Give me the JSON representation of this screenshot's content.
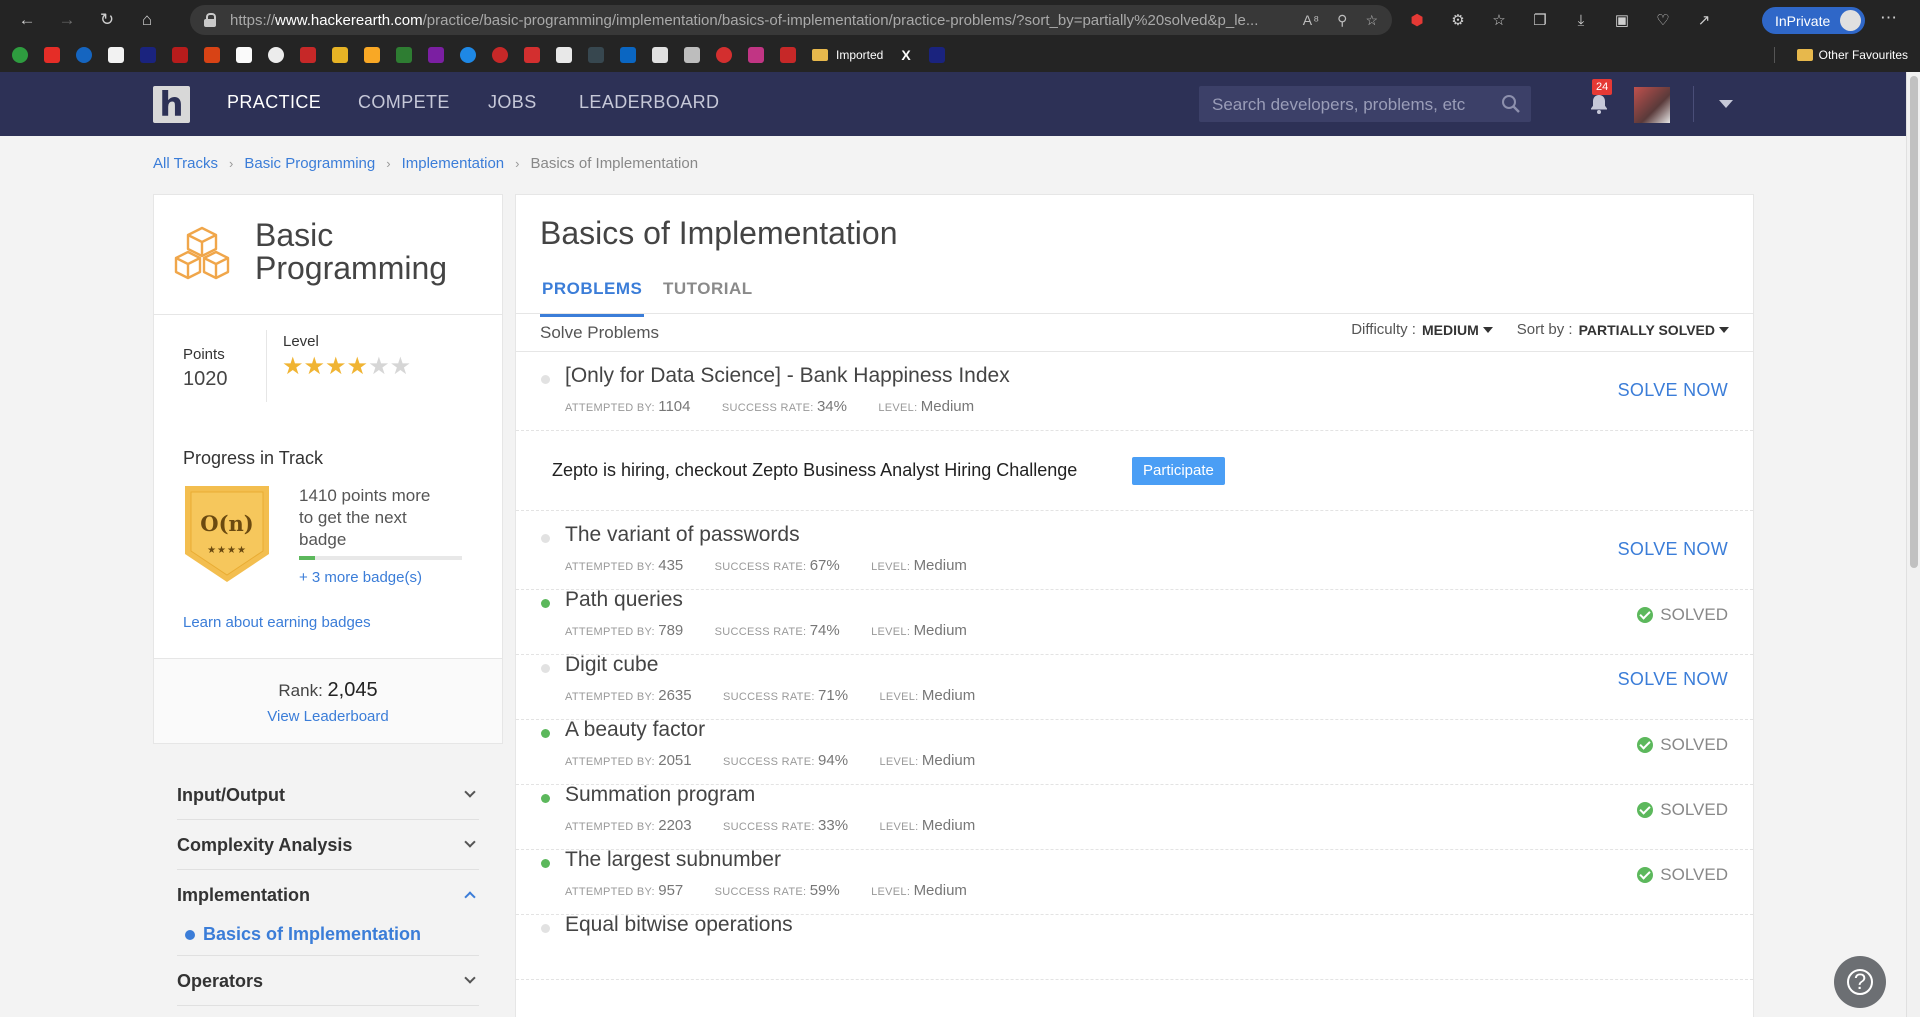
{
  "browser": {
    "url_proto": "https://",
    "url_host": "www.hackerearth.com",
    "url_path": "/practice/basic-programming/implementation/basics-of-implementation/practice-problems/?sort_by=partially%20solved&p_le...",
    "inprivate_label": "InPrivate",
    "bookmark_imported": "Imported",
    "bookmark_x": "X",
    "other_favourites": "Other Favourites"
  },
  "header": {
    "logo": "h",
    "nav": [
      "PRACTICE",
      "COMPETE",
      "JOBS",
      "LEADERBOARD"
    ],
    "search_placeholder": "Search developers, problems, etc",
    "notification_count": "24"
  },
  "breadcrumb": [
    "All Tracks",
    "Basic Programming",
    "Implementation",
    "Basics of Implementation"
  ],
  "track": {
    "title": "Basic Programming",
    "points_label": "Points",
    "points": "1020",
    "level_label": "Level",
    "level_stars": 4,
    "level_max": 6,
    "progress_title": "Progress in Track",
    "badge_text": "O(n)",
    "badge_stars": "★★★★",
    "progress_text": "1410 points more to get the next badge",
    "progress_fraction": 0.1,
    "more_badges": "+ 3 more badge(s)",
    "learn_link": "Learn about earning badges",
    "rank_label": "Rank:",
    "rank": "2,045",
    "view_leaderboard": "View Leaderboard"
  },
  "topics": {
    "items": [
      "Input/Output",
      "Complexity Analysis",
      "Implementation",
      "Operators"
    ],
    "sub_active": "Basics of Implementation"
  },
  "main": {
    "title": "Basics of Implementation",
    "tabs": [
      "PROBLEMS",
      "TUTORIAL"
    ],
    "solve_label": "Solve Problems",
    "difficulty_label": "Difficulty :",
    "difficulty_value": "MEDIUM",
    "sort_label": "Sort by :",
    "sort_value": "PARTIALLY SOLVED",
    "meta_labels": {
      "attempted": "ATTEMPTED BY:",
      "success": "SUCCESS RATE:",
      "level": "LEVEL:"
    },
    "action_labels": {
      "solve_now": "SOLVE NOW",
      "solved": "SOLVED"
    },
    "ad_text": "Zepto is hiring, checkout Zepto Business Analyst Hiring Challenge",
    "ad_button": "Participate",
    "problems": [
      {
        "title": "[Only for Data Science] - Bank Happiness Index",
        "attempted": "1104",
        "success": "34%",
        "level": "Medium",
        "status": "solve"
      },
      {
        "title": "The variant of passwords",
        "attempted": "435",
        "success": "67%",
        "level": "Medium",
        "status": "solve"
      },
      {
        "title": "Path queries",
        "attempted": "789",
        "success": "74%",
        "level": "Medium",
        "status": "solved"
      },
      {
        "title": "Digit cube",
        "attempted": "2635",
        "success": "71%",
        "level": "Medium",
        "status": "solve"
      },
      {
        "title": "A beauty factor",
        "attempted": "2051",
        "success": "94%",
        "level": "Medium",
        "status": "solved"
      },
      {
        "title": "Summation program",
        "attempted": "2203",
        "success": "33%",
        "level": "Medium",
        "status": "solved"
      },
      {
        "title": "The largest subnumber",
        "attempted": "957",
        "success": "59%",
        "level": "Medium",
        "status": "solved"
      },
      {
        "title": "Equal bitwise operations",
        "attempted": "",
        "success": "",
        "level": "",
        "status": "solve"
      }
    ]
  },
  "help": {
    "label": "?"
  }
}
